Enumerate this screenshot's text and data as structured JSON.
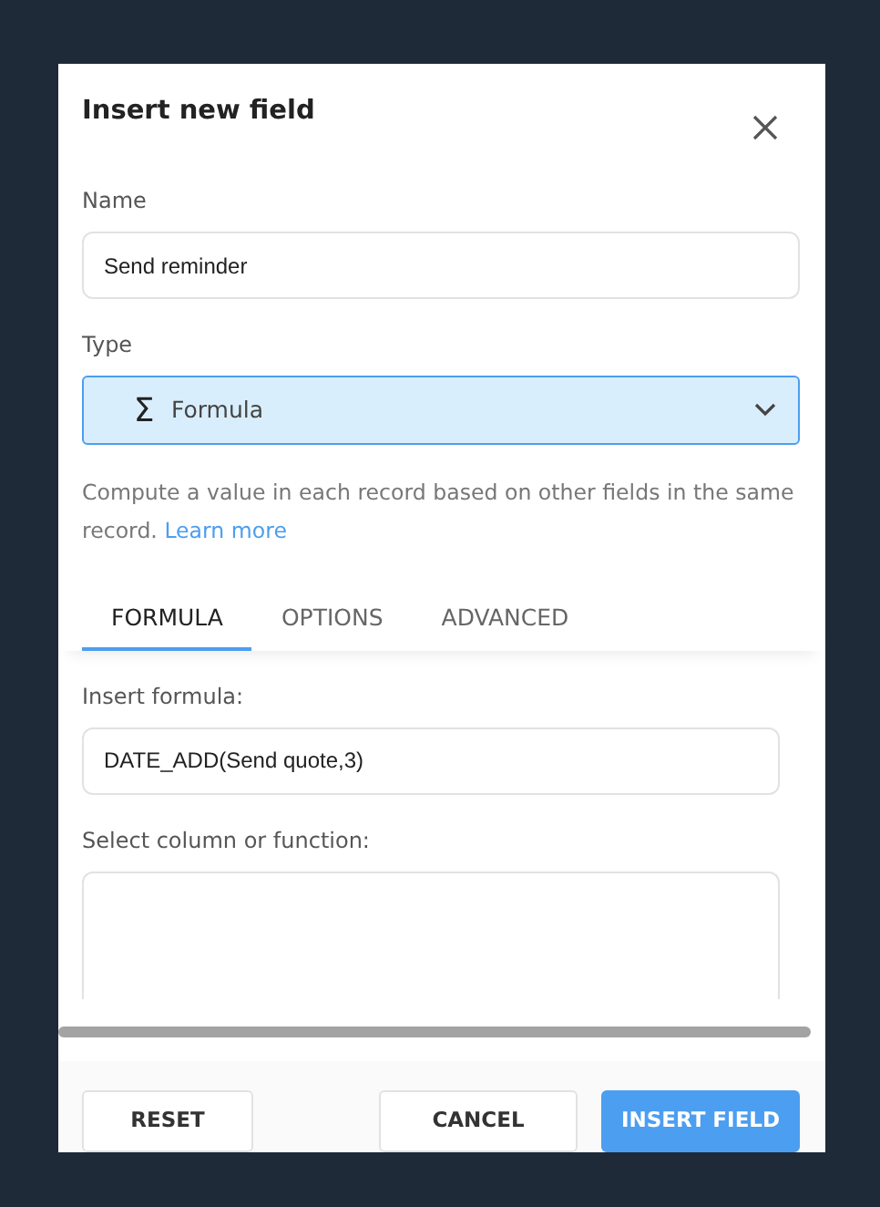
{
  "dialog": {
    "title": "Insert new field"
  },
  "name_field": {
    "label": "Name",
    "value": "Send reminder"
  },
  "type_field": {
    "label": "Type",
    "icon_char": "Σ",
    "value": "Formula"
  },
  "help": {
    "text": "Compute a value in each record based on other fields in the same record.",
    "link": "Learn more"
  },
  "tabs": [
    {
      "label": "FORMULA",
      "selected": true
    },
    {
      "label": "OPTIONS",
      "selected": false
    },
    {
      "label": "ADVANCED",
      "selected": false
    }
  ],
  "formula_field": {
    "label": "Insert formula:",
    "value": "DATE_ADD(Send quote,3)"
  },
  "select_field": {
    "label": "Select column or function:"
  },
  "buttons": [
    {
      "label": "RESET",
      "kind": "plain"
    },
    {
      "label": "CANCEL",
      "kind": "plain"
    },
    {
      "label": "INSERT FIELD",
      "kind": "primary"
    }
  ]
}
